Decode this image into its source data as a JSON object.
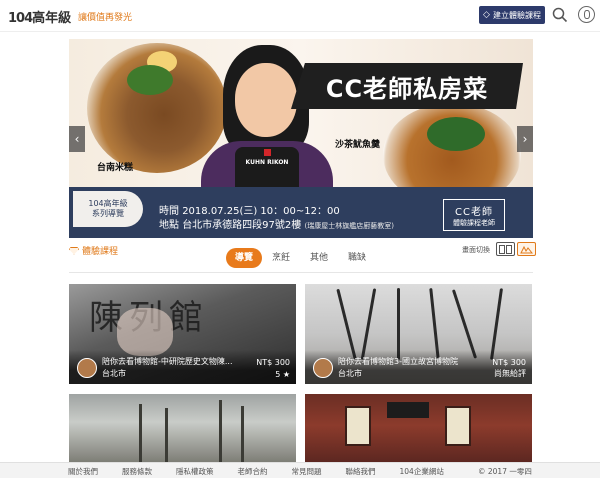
{
  "header": {
    "logo_num": "104",
    "logo_text": "高年級",
    "slogan": "讓價值再發光",
    "signup_label": "建立體驗課程"
  },
  "banner": {
    "title": "CC老師私房菜",
    "dish_left": "台南米糕",
    "dish_right": "沙茶魷魚羹",
    "apron_brand": "KUHN RIKON",
    "series_line1": "104高年級",
    "series_line2": "系列導覽",
    "time_label": "時間",
    "time_value": "2018.07.25(三) 10：00~12：00",
    "place_label": "地點",
    "place_value": "台北市承德路四段97號2樓",
    "place_note": "(瑞康屋士林旗艦店廚藝教室)",
    "teacher_name": "CC老師",
    "teacher_sub": "體驗課程老師"
  },
  "section": {
    "title": "體驗課程",
    "view_switch_label": "畫面切換"
  },
  "tabs": [
    {
      "label": "導覽"
    },
    {
      "label": "烹飪"
    },
    {
      "label": "其他"
    },
    {
      "label": "職缺"
    }
  ],
  "cards": [
    {
      "title": "陪你去看博物館-中研院歷史文物陳...",
      "price": "NT$ 300",
      "location": "台北市",
      "rating": "5 ★"
    },
    {
      "title": "陪你去看博物館3-國立故宮博物院",
      "price": "NT$ 300",
      "location": "台北市",
      "rating": "尚無給評"
    }
  ],
  "footer": {
    "links": [
      "關於我們",
      "服務條款",
      "隱私權政策",
      "老師合約",
      "常見問題",
      "聯絡我們",
      "104企業網站"
    ],
    "copyright": "© 2017 一零四"
  },
  "colors": {
    "accent": "#e87a1b",
    "navy": "#2d3a6b",
    "info_bar": "#2e3e5e"
  }
}
